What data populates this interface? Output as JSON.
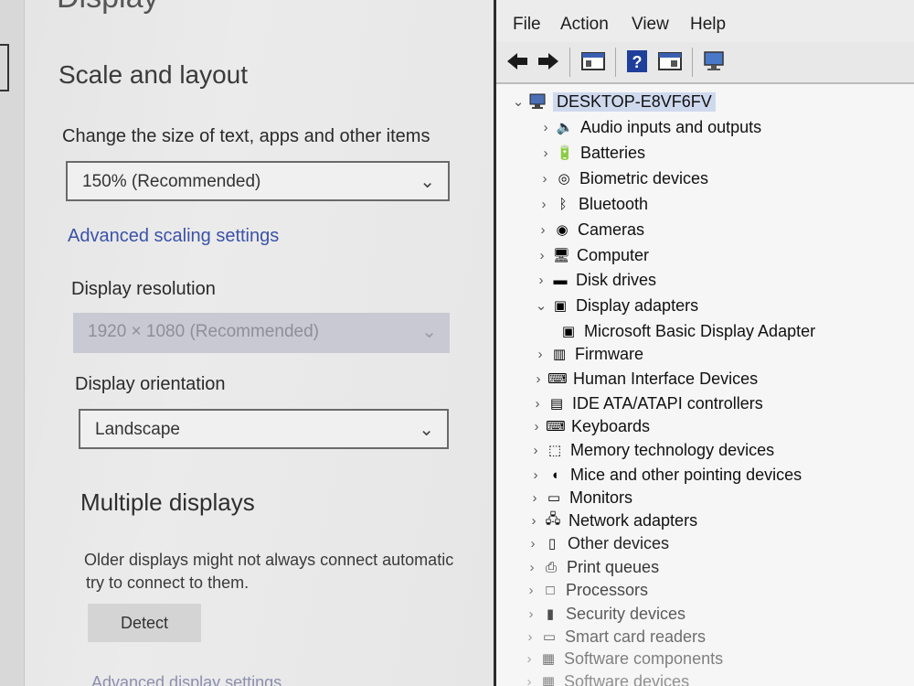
{
  "settings": {
    "title": "Display",
    "section_title": "Scale and layout",
    "scale_label": "Change the size of text, apps and other items",
    "scale_value": "150% (Recommended)",
    "advanced_link": "Advanced scaling settings",
    "resolution_label": "Display resolution",
    "resolution_value": "1920 × 1080 (Recommended)",
    "orientation_label": "Display orientation",
    "orientation_value": "Landscape",
    "multi_title": "Multiple displays",
    "multi_text_1": "Older displays might not always connect automatic",
    "multi_text_2": "try to connect to them.",
    "detect_button": "Detect",
    "faint_link": "Advanced display settings"
  },
  "devmgr": {
    "menu": [
      "File",
      "Action",
      "View",
      "Help"
    ],
    "root": "DESKTOP-E8VF6FV",
    "categories": [
      {
        "label": "Audio inputs and outputs",
        "icon": "speaker-icon",
        "expander": ">",
        "glyph": "🔈"
      },
      {
        "label": "Batteries",
        "icon": "battery-icon",
        "expander": ">",
        "glyph": "🔋"
      },
      {
        "label": "Biometric devices",
        "icon": "fingerprint-icon",
        "expander": ">",
        "glyph": "◎"
      },
      {
        "label": "Bluetooth",
        "icon": "bluetooth-icon",
        "expander": ">",
        "glyph": "ᛒ"
      },
      {
        "label": "Cameras",
        "icon": "camera-icon",
        "expander": ">",
        "glyph": "◉"
      },
      {
        "label": "Computer",
        "icon": "monitor-icon",
        "expander": ">",
        "glyph": "🖥"
      },
      {
        "label": "Disk drives",
        "icon": "disk-icon",
        "expander": ">",
        "glyph": "▬"
      },
      {
        "label": "Display adapters",
        "icon": "display-adapter-icon",
        "expander": "v",
        "glyph": "▣"
      },
      {
        "label": "Microsoft Basic Display Adapter",
        "icon": "display-adapter-icon",
        "expander": "",
        "glyph": "▣",
        "child": true
      },
      {
        "label": "Firmware",
        "icon": "firmware-icon",
        "expander": ">",
        "glyph": "▥"
      },
      {
        "label": "Human Interface Devices",
        "icon": "hid-icon",
        "expander": ">",
        "glyph": "⌨"
      },
      {
        "label": "IDE ATA/ATAPI controllers",
        "icon": "controller-icon",
        "expander": ">",
        "glyph": "▤"
      },
      {
        "label": "Keyboards",
        "icon": "keyboard-icon",
        "expander": ">",
        "glyph": "⌨"
      },
      {
        "label": "Memory technology devices",
        "icon": "memory-icon",
        "expander": ">",
        "glyph": "⬚"
      },
      {
        "label": "Mice and other pointing devices",
        "icon": "mouse-icon",
        "expander": ">",
        "glyph": "◖"
      },
      {
        "label": "Monitors",
        "icon": "monitor-icon",
        "expander": ">",
        "glyph": "▭"
      },
      {
        "label": "Network adapters",
        "icon": "network-icon",
        "expander": ">",
        "glyph": "🖧"
      },
      {
        "label": "Other devices",
        "icon": "other-devices-icon",
        "expander": ">",
        "glyph": "▯"
      },
      {
        "label": "Print queues",
        "icon": "printer-icon",
        "expander": ">",
        "glyph": "⎙"
      },
      {
        "label": "Processors",
        "icon": "processor-icon",
        "expander": ">",
        "glyph": "□"
      },
      {
        "label": "Security devices",
        "icon": "security-icon",
        "expander": ">",
        "glyph": "▮"
      },
      {
        "label": "Smart card readers",
        "icon": "smart-card-icon",
        "expander": ">",
        "glyph": "▭"
      },
      {
        "label": "Software components",
        "icon": "software-icon",
        "expander": ">",
        "glyph": "▦"
      },
      {
        "label": "Software devices",
        "icon": "software-icon",
        "expander": ">",
        "glyph": "▦"
      }
    ]
  },
  "colors": {
    "link": "#3b52a8",
    "selection": "#cfd9ee",
    "disabled_dropdown": "#c9c9d3"
  }
}
